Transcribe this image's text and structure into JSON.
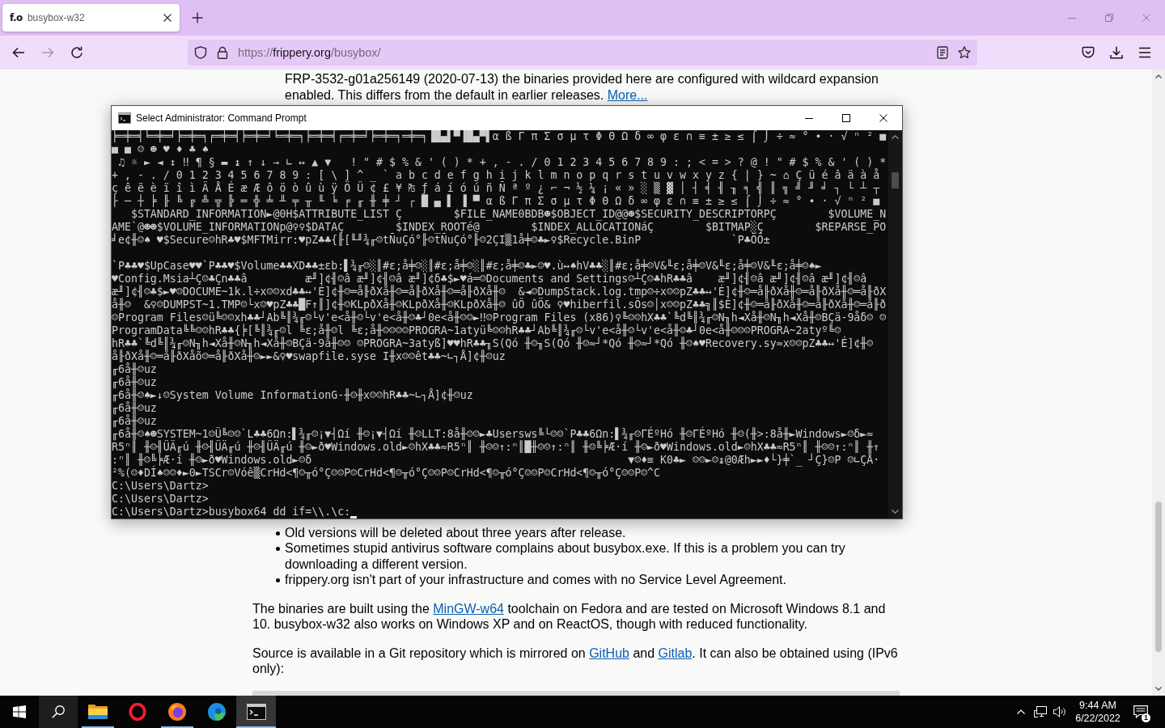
{
  "browser": {
    "tabs": [
      {
        "favicon_text": "f.o",
        "title": "busybox-w32",
        "selected": true
      }
    ],
    "nav_buttons": [
      {
        "kind": "back",
        "disabled": false
      },
      {
        "kind": "forward",
        "disabled": true
      },
      {
        "kind": "reload",
        "disabled": false
      }
    ],
    "address": {
      "prefix": "https://",
      "domain": "frippery.org",
      "path": "/busybox/"
    }
  },
  "page": {
    "intro": [
      {
        "kind": "text",
        "text": "FRP-3532-g01a256149 (2020-07-13) the binaries provided here are configured with wildcard expansion enabled. This differs from the default in earlier releases. "
      },
      {
        "kind": "link",
        "text": "More..."
      }
    ],
    "list": [
      {
        "parts": [
          {
            "kind": "text",
            "text": "Old versions will be deleted about three years after release."
          }
        ]
      },
      {
        "parts": [
          {
            "kind": "text",
            "text": "Sometimes stupid antivirus software complains about busybox.exe. If this is a problem you can try downloading a different version."
          }
        ]
      },
      {
        "parts": [
          {
            "kind": "text",
            "text": "frippery.org isn't part of your infrastructure and comes with no Service Level Agreement."
          }
        ]
      }
    ],
    "paragraphs": [
      {
        "parts": [
          {
            "kind": "text",
            "text": "The binaries are built using the "
          },
          {
            "kind": "link",
            "text": "MinGW-w64"
          },
          {
            "kind": "text",
            "text": " toolchain on Fedora and are tested on Microsoft Windows 8.1 and 10. busybox-w32 also works on Windows XP and on ReactOS, though with reduced functionality."
          }
        ]
      },
      {
        "parts": [
          {
            "kind": "text",
            "text": "Source is available in a Git repository which is mirrored on "
          },
          {
            "kind": "link",
            "text": "GitHub"
          },
          {
            "kind": "text",
            "text": " and "
          },
          {
            "kind": "link",
            "text": "Gitlab"
          },
          {
            "kind": "text",
            "text": ". It can also be obtained using (IPv6 only):"
          }
        ]
      }
    ]
  },
  "terminal": {
    "title": "Select Administrator: Command Prompt",
    "cursor_visible": true,
    "blocks": [
      {
        "lines": [
          "╞═╪═╡╘═╪═╛╞═╪═╕╒═╪═╡╞═╪═╛╘═╪═╕╞═╪═╡╒═╪═╛╞═╪═╕═╪═╕▐█▄▌▀▐█▄▀▌α ß Γ π Σ σ µ τ Φ Θ Ω δ ∞ φ ε ∩ ≡ ± ≥ ≤ ⌠ ⌡ ÷ ≈ ° ∙ · √ ⁿ ² ■",
          "■ ■ ☺ ☻ ♥ ♦ ♣ ♠",
          " ♫ ☼ ► ◄ ↕ ‼ ¶ § ▬ ↨ ↑ ↓ → ∟ ↔ ▲ ▼   ! \" # $ % & ' ( ) * + , - . / 0 1 2 3 4 5 6 7 8 9 : ; < = > ? @ ! \" # $ % & ' ( ) *",
          "+ , - . / 0 1 2 3 4 5 6 7 8 9 : [ \\ ] ^ _ ` a b c d e f g h i j k l m n o p q r s t u v w x y z { | } ~ ⌂ Ç ü é â ä à å",
          "ç ê ë è ï î ì Ä Å É æ Æ ô ö ò û ù ÿ Ö Ü ¢ £ ¥ ₧ ƒ á í ó ú ñ Ñ ª º ¿ ⌐ ¬ ½ ¼ ¡ « » ░ ▒ ▓ │ ┤ ╡ ╢ ╖ ╕ ╣ ║ ╗ ╝ ╜ ╛ ┐ └ ┴ ┬",
          "├ ─ ┼ ╞ ╟ ╚ ╔ ╩ ╦ ╠ ═ ╬ ╧ ╨ ╤ ╥ ╙ ╘ ╒ ╓ ╫ ╪ ┘ ┌ █ ▄ ▌ ▐ ▀ α ß Γ π Σ σ µ τ Φ Θ Ω δ ∞ φ ε ∩ ≡ ± ≥ ≤ ⌠ ⌡ ÷ ≈ ° ∙ · √ ⁿ ² ■",
          "   $STANDARD_INFORMATION►@0H$ATTRIBUTE_LIST Ç        $FILE_NAME0BDB☻$OBJECT_ID@@☻$SECURITY_DESCRIPTORPÇ        $VOLUME_N",
          "AME`@☻☻$VOLUME_INFORMATIONp@♀♀$DATAÇ        $INDEX_ROOTé@        $INDEX_ALLOCATIONáÇ        $BITMAP░Ç        $REPARSE_PO",
          "╛e¢╫☺♠ ♥$Secure☺hR♣♥$MFTMirr:♥pZ♣♣{╟[╙╜¾╓☺tÑuÇó°╟☺tÑuÇó°╟☺2ÇI▒1å╪☺♣►♀$Recycle.BinP              `P♣ÕÕ±"
        ]
      },
      {
        "lines": [
          "`P♣♣♥$UpCase♥♥`P♣♣♥$Volume♣♣XD♣♣±εb:▌¾╓☺░║#ε;å╪☺░║#ε;å╪☺░║#ε;å╪☺♣►☺♥.ù↔♠hV♣♣░║#ε;å╪☺V&╙ε;å╪☺V&╙ε;å╪☺V&╙ε;å╪☺♠►",
          "♥Config.Msia┴Ç☺♣Çn♣♣â         æ╜]¢╢☺â æ╜]¢╢☺â æ╜]¢δ♣$►♥á═☺Documents and Settings☺┴Ç☺♣hR♣♣â    æ╜]¢╢☺â æ╜]¢╢☺â æ╜]¢╢☺â",
          "æ╜]¢╢☺♣$►♥☺DOCUME~1k.l÷x☺☺xd♣♣↔'É]¢╫☺═å╟ðXå╫☺═å╟ðXå╫☺═å╟ðXå╫☺  &◄☺DumpStack.log.tmp☺÷x☺☺pZ♣♣↔'É]¢╫☺═å╟ðXå╫☺═å╟ðXå╫☺═å╟ðX",
          "å╫☺  &♀☺DUMPST~1.TMP☺└x☺♥pZ♣♣█F↑║]¢╫☺KLpðXå╫☺KLpðXå╫☺KLpðXå╫☺ ûÖ ûÖ& ♀♥hiberfil.sÕs☺│x☺☺pZ♣♣╗║$É]¢╫☺═å╟ðXå╫☺═å╟ðXå╫☺═å╟ð",
          "☺Program Files☺ü╚☺☺xh♣♣┘Ab╚║¾╓☺└v'e<å╫☺└v'e<å╫☺♣┘0e<å╫☺☺►‼☺Program Files (x86)♀╚☺☺hX♣♣`╚d╚║¾╓☺N╖h◄Xå╫☺N╖h◄Xå╫☺BÇä-9åδ☺ ☺",
          "ProgramData╚╚☺☺hR♣♣{╞[╚║¾╓☺l ╚ε;å╫☺l ╚ε;å╫☺☺☺☺PROGRA~1atyü╚☺☺hR♣♣┘Ab╚║¾╓☺└v'e<å╫☺└v'e<å╫☺♣┘0e<å╫☺☺☺PROGRA~2atyº╚☺",
          "hR♣♣`╚d╚║¾╓☺N╖h◄Xå╫☺N╖h◄Xå╫☺BÇä-9å╫☺☺ ☺PROGRA~3atyß]♥♥hR♣♣╖S(Qó ╫☺╖S(Qó ╫☺≈┘*Qó ╫☺≈┘*Qó ╫☺♠♥Recovery.sy≈x☺☺pZ♣♣↔'É]¢╫☺",
          "å╟ðXå╫☺═å╟ðXåõ☺═å╟ðXå╫☺►►&♀♥swapfile.syse I╫x☺☺êt♣♣~∟┐Å]¢╫☺uz",
          "╓6å╫☺uz",
          "╓6å╫☺uz",
          "╓6å╫☺♠►↓☺System Volume InformationG-╫☺╫x☺☺hR♣♣~∟┐Å]¢╫☺uz",
          "╓6å╫☺uz",
          "╓6å╫☺uz",
          "╓6å╫☺♠☻SYSTEM~1☺Ü╚☺☺`L♣♣6Ωn:▌¾╓☺¡▼┤Ωí ╫☺¡▼┤Ωí ╫☺LLT:8å╫☺☺►♣Usersws╚└☺☺`P♣♣6Ωn:▌¾╓☺ΓÉºHó ╫☺ΓÉºHó ╫☺(╫>:8å╫►Windows►☺δ►≈",
          "R5ⁿ║ ╫☺╢ÜÄ╓ú ╫☺╢ÜÄ╓ú ╫☺╢ÜÄ╓ú ╫☺►ð♥Windows.old►☺hX♣♣≈R5ⁿ║ ╫☺☺↑:ⁿ║█╫☺☺↑:ⁿ║ ╫☺╚╞Æ·í ╫☺►ð♥Windows.old►☺hX♣♣≈R5ⁿ║ ╫☺☺↑:ⁿ║ ╫↑",
          ":ⁿ║ ╫☺╚╞Æ·í ╫☺►ð♥Windows.old►☺δ                                                 ▼☺♦≡ K0♣► ☺☺►☺↨@0Æh►►♦└}╪`_ ┘Ç}☺P ☺∟ÇÅ·",
          "²%(☺♦DÍ♠☺☺♦►0►TSCr☺Vóê▒CrHd<¶☺╥ó°Ç☺☺P☺CrHd<¶☺╥ó°Ç☺☺P☺CrHd<¶☺╥ó°Ç☺☺P☺CrHd<¶☺╥ó°Ç☺☺P☺^C",
          "C:\\Users\\Dartz>",
          "C:\\Users\\Dartz>",
          "C:\\Users\\Dartz>busybox64 dd if=\\\\.\\c:"
        ]
      }
    ]
  },
  "taskbar": {
    "apps": [
      {
        "kind": "folder",
        "running": true,
        "active": false
      },
      {
        "kind": "ring",
        "running": false,
        "active": false
      },
      {
        "kind": "orb",
        "running": true,
        "active": false
      },
      {
        "kind": "swirl",
        "running": false,
        "active": false
      },
      {
        "kind": "terminal",
        "running": true,
        "active": true
      }
    ],
    "clock": {
      "time": "9:44 AM",
      "date": "6/22/2022"
    },
    "notification_count": "1"
  }
}
